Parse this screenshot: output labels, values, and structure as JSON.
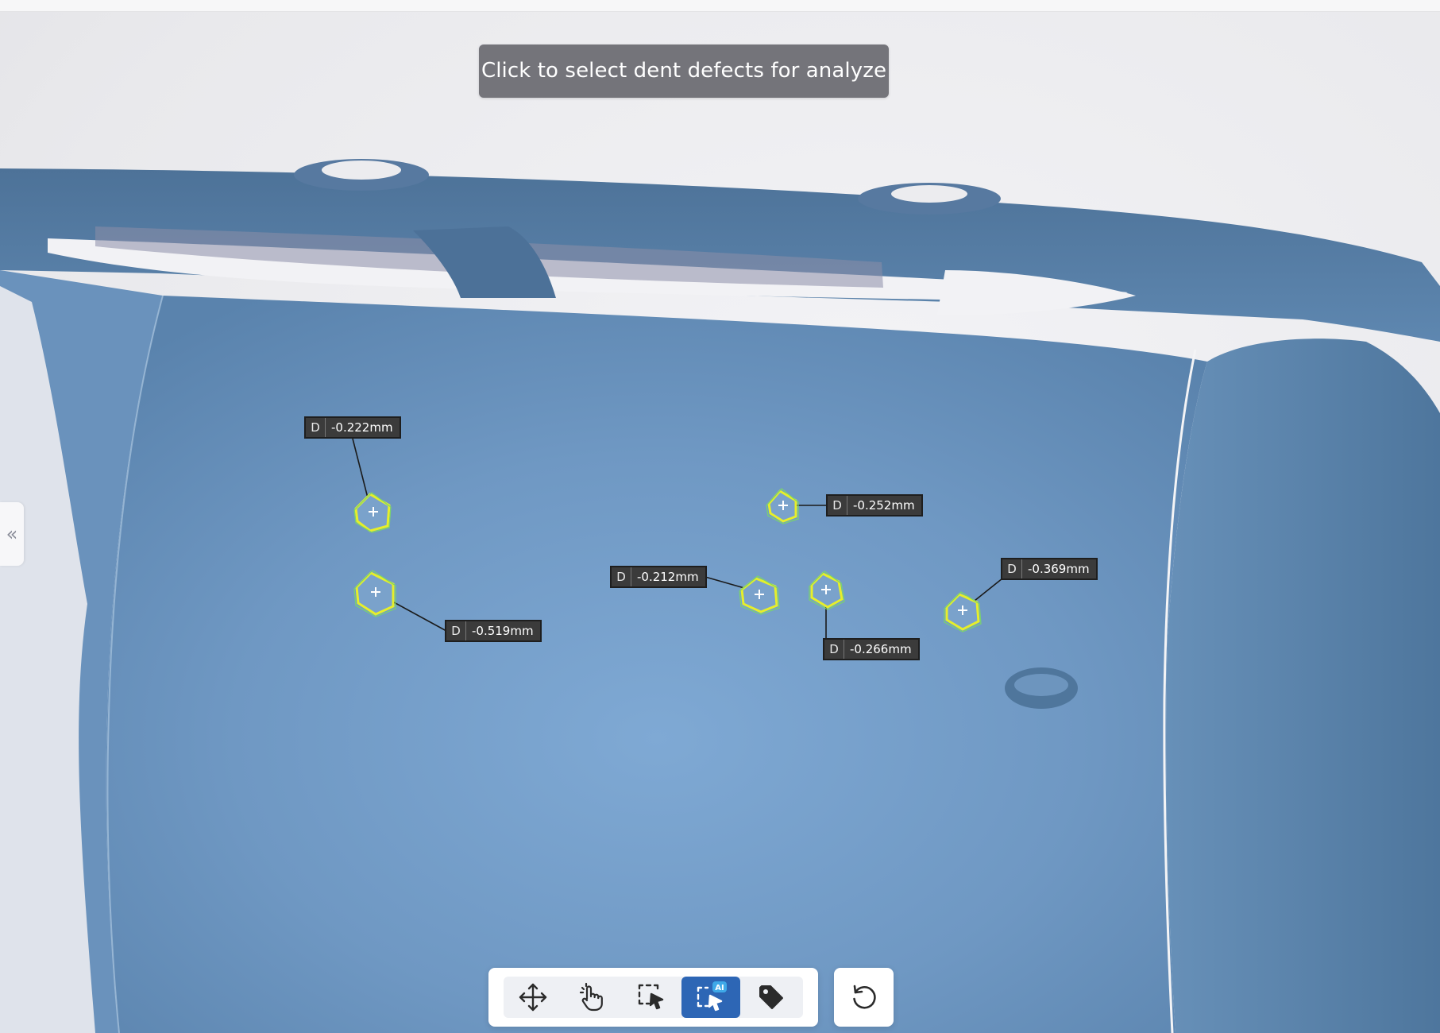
{
  "hint": {
    "text": "Click to select dent defects for analyze"
  },
  "side_panel": {
    "collapse_glyph": "«"
  },
  "defects": [
    {
      "prefix": "D",
      "value": "-0.222mm"
    },
    {
      "prefix": "D",
      "value": "-0.519mm"
    },
    {
      "prefix": "D",
      "value": "-0.252mm"
    },
    {
      "prefix": "D",
      "value": "-0.212mm"
    },
    {
      "prefix": "D",
      "value": "-0.266mm"
    },
    {
      "prefix": "D",
      "value": "-0.369mm"
    }
  ],
  "toolbar": {
    "tools": [
      {
        "icon": "move-icon"
      },
      {
        "icon": "hand-pointer-icon"
      },
      {
        "icon": "box-select-icon"
      },
      {
        "icon": "ai-select-icon",
        "badge": "AI",
        "active": true
      },
      {
        "icon": "tag-icon"
      }
    ],
    "reset_icon": "reset-icon"
  },
  "colors": {
    "model_surface": "#7aa3cc",
    "model_edge": "#4f769c",
    "marker_yellow": "#e6ef2a",
    "marker_green": "#7bd56a",
    "label_background": "#3b3b3b",
    "active_tool": "#2d66b5",
    "hint_background": "#74747a"
  }
}
